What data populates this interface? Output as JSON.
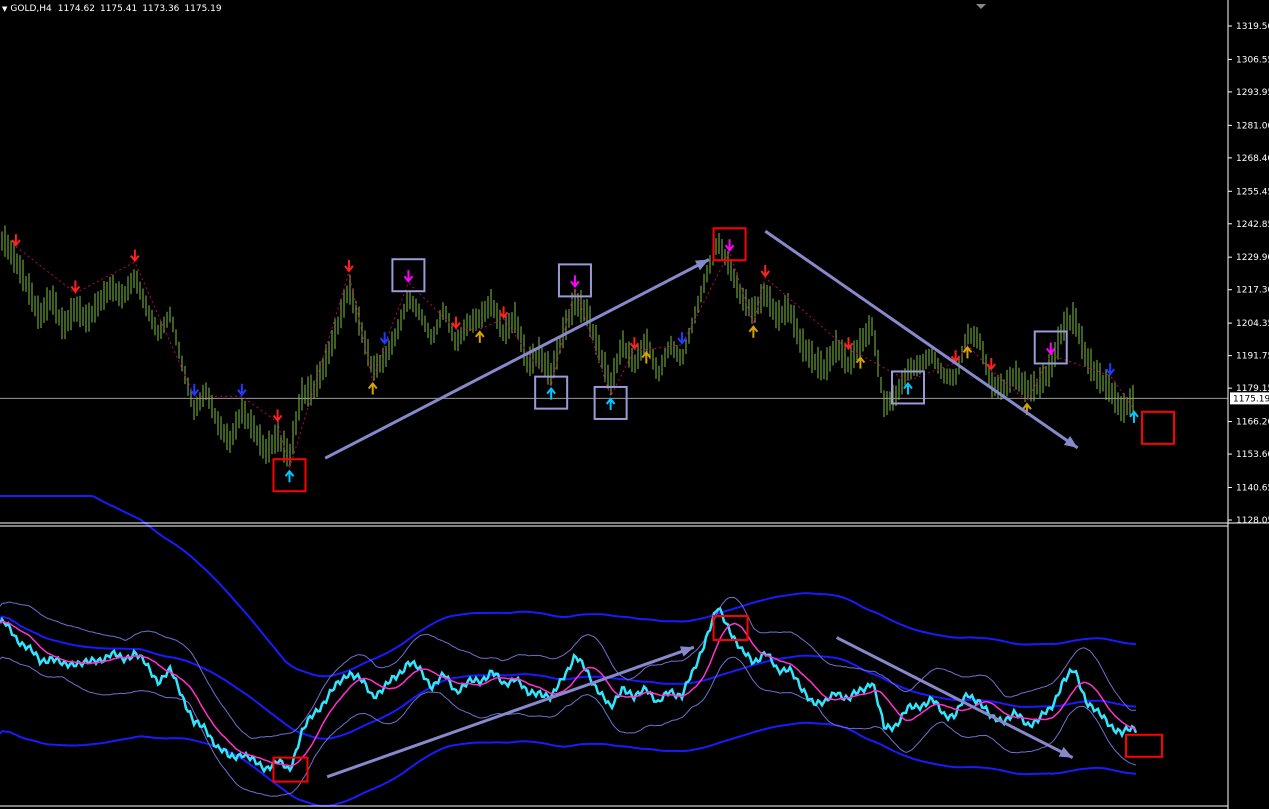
{
  "header": {
    "symbol": "GOLD,H4",
    "open": "1174.62",
    "high": "1175.41",
    "low": "1173.36",
    "close": "1175.19"
  },
  "colors": {
    "background": "#000000",
    "axis": "#ffffff",
    "candles": "#7fbf3f",
    "arrow_up_high_confidence": "#00c8ff",
    "arrow_down_high_confidence": "#ff00ff",
    "arrow_down_red": "#ff2020",
    "arrow_down_blue": "#1e3cff",
    "arrow_up_yellow": "#d4a400",
    "trend_arrows": "#8888cc",
    "highlight_box_red": "#ff0000",
    "highlight_box_purple": "#9a9ad6",
    "indicator_line": "#33e6ff",
    "indicator_ma": "#ff33cc",
    "outer_bands": "#1a1aff",
    "inner_bands": "#6f6fcf",
    "zigzag": "#c00060"
  },
  "chart_data": [
    {
      "type": "candlestick",
      "title": "GOLD,H4",
      "price_axis_ticks": [
        "1319.50",
        "1306.55",
        "1293.95",
        "1281.00",
        "1268.40",
        "1255.45",
        "1242.85",
        "1229.90",
        "1217.30",
        "1204.35",
        "1191.75",
        "1179.15",
        "1166.20",
        "1153.60",
        "1140.65",
        "1128.05"
      ],
      "current_price_label": "1175.19",
      "ylim": [
        1128.05,
        1319.5
      ],
      "close_series": [
        1236,
        1228,
        1218,
        1206,
        1214,
        1202,
        1210,
        1205,
        1212,
        1218,
        1214,
        1222,
        1210,
        1200,
        1208,
        1188,
        1170,
        1178,
        1165,
        1158,
        1170,
        1163,
        1154,
        1160,
        1152,
        1176,
        1178,
        1188,
        1202,
        1218,
        1202,
        1186,
        1190,
        1200,
        1214,
        1208,
        1198,
        1210,
        1196,
        1204,
        1206,
        1212,
        1200,
        1206,
        1188,
        1192,
        1184,
        1200,
        1212,
        1208,
        1194,
        1180,
        1196,
        1188,
        1198,
        1184,
        1196,
        1190,
        1206,
        1222,
        1236,
        1226,
        1214,
        1208,
        1216,
        1206,
        1210,
        1196,
        1190,
        1186,
        1195,
        1188,
        1196,
        1203,
        1172,
        1176,
        1186,
        1188,
        1192,
        1184,
        1183,
        1200,
        1198,
        1180,
        1179,
        1184,
        1178,
        1180,
        1186,
        1202,
        1206,
        1190,
        1183,
        1178,
        1170,
        1175
      ],
      "signals": [
        {
          "kind": "down-red",
          "index": 1
        },
        {
          "kind": "down-red",
          "index": 6
        },
        {
          "kind": "down-red",
          "index": 11
        },
        {
          "kind": "down-blue",
          "index": 16
        },
        {
          "kind": "down-blue",
          "index": 20
        },
        {
          "kind": "down-red",
          "index": 23
        },
        {
          "kind": "up-cyan",
          "index": 24
        },
        {
          "kind": "down-red",
          "index": 29
        },
        {
          "kind": "up-yellow",
          "index": 31
        },
        {
          "kind": "down-blue",
          "index": 32
        },
        {
          "kind": "down-magenta",
          "index": 34
        },
        {
          "kind": "down-red",
          "index": 38
        },
        {
          "kind": "up-yellow",
          "index": 40
        },
        {
          "kind": "down-red",
          "index": 42
        },
        {
          "kind": "up-cyan",
          "index": 46
        },
        {
          "kind": "down-magenta",
          "index": 48
        },
        {
          "kind": "up-cyan",
          "index": 51
        },
        {
          "kind": "down-red",
          "index": 53
        },
        {
          "kind": "up-yellow",
          "index": 54
        },
        {
          "kind": "down-blue",
          "index": 57
        },
        {
          "kind": "down-magenta",
          "index": 61
        },
        {
          "kind": "up-yellow",
          "index": 63
        },
        {
          "kind": "down-red",
          "index": 64
        },
        {
          "kind": "down-red",
          "index": 71
        },
        {
          "kind": "up-yellow",
          "index": 72
        },
        {
          "kind": "up-cyan",
          "index": 76
        },
        {
          "kind": "down-red",
          "index": 80
        },
        {
          "kind": "up-yellow",
          "index": 81
        },
        {
          "kind": "down-red",
          "index": 83
        },
        {
          "kind": "up-yellow",
          "index": 86
        },
        {
          "kind": "down-magenta",
          "index": 88
        },
        {
          "kind": "down-blue",
          "index": 93
        },
        {
          "kind": "up-cyan",
          "index": 95
        }
      ],
      "highlight_boxes": [
        {
          "color": "red",
          "index": 24
        },
        {
          "color": "purple",
          "index": 34
        },
        {
          "color": "purple",
          "index": 46
        },
        {
          "color": "purple",
          "index": 48
        },
        {
          "color": "purple",
          "index": 51
        },
        {
          "color": "red",
          "index": 61
        },
        {
          "color": "purple",
          "index": 76
        },
        {
          "color": "purple",
          "index": 88
        },
        {
          "color": "red",
          "index": 96
        }
      ],
      "trend_arrows": [
        {
          "from_index": 27,
          "to_index": 58,
          "from_price": 1152,
          "to_price": 1229
        },
        {
          "from_index": 64,
          "to_index": 89,
          "from_price": 1240,
          "to_price": 1156
        }
      ]
    },
    {
      "type": "line",
      "title": "",
      "series": [
        {
          "name": "",
          "color": "#33e6ff",
          "values": [
            0.72,
            0.66,
            0.62,
            0.56,
            0.58,
            0.54,
            0.56,
            0.55,
            0.57,
            0.59,
            0.57,
            0.6,
            0.54,
            0.48,
            0.52,
            0.42,
            0.3,
            0.28,
            0.2,
            0.16,
            0.18,
            0.14,
            0.12,
            0.14,
            0.11,
            0.26,
            0.34,
            0.4,
            0.46,
            0.52,
            0.48,
            0.42,
            0.45,
            0.5,
            0.56,
            0.52,
            0.46,
            0.5,
            0.44,
            0.47,
            0.48,
            0.52,
            0.46,
            0.5,
            0.42,
            0.44,
            0.4,
            0.5,
            0.58,
            0.52,
            0.44,
            0.36,
            0.46,
            0.4,
            0.46,
            0.38,
            0.44,
            0.42,
            0.52,
            0.66,
            0.78,
            0.7,
            0.6,
            0.56,
            0.6,
            0.52,
            0.54,
            0.44,
            0.4,
            0.38,
            0.44,
            0.4,
            0.44,
            0.48,
            0.28,
            0.3,
            0.36,
            0.38,
            0.4,
            0.34,
            0.34,
            0.42,
            0.4,
            0.32,
            0.32,
            0.34,
            0.3,
            0.32,
            0.36,
            0.48,
            0.52,
            0.4,
            0.34,
            0.3,
            0.26,
            0.28
          ]
        }
      ]
    }
  ]
}
